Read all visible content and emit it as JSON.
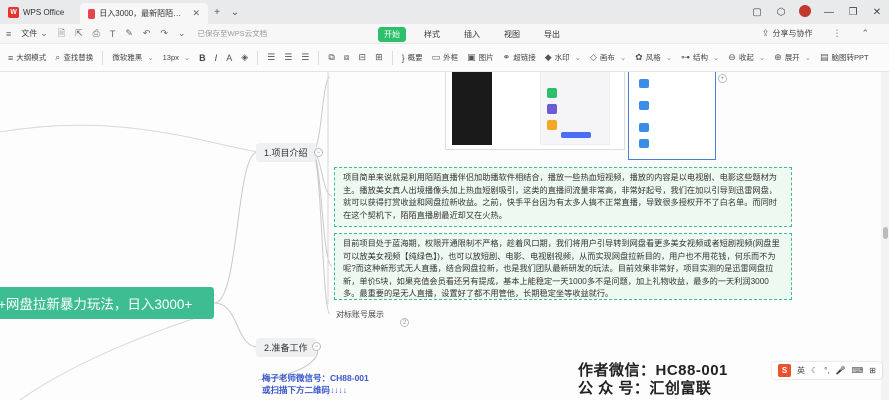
{
  "tabs": {
    "home_label": "WPS Office",
    "doc_label": "日入3000，最新陌陌无人直播网盘",
    "new_tab": "+"
  },
  "menubar": {
    "file": "文件",
    "saved_status": "已保存至WPS云文档",
    "tabs": [
      "开始",
      "样式",
      "插入",
      "视图",
      "导出"
    ],
    "share": "分享与协作"
  },
  "toolbar": {
    "outline": "大纲模式",
    "find_replace": "查找替换",
    "font": "微软雅黑",
    "font_size": "13px",
    "bold": "B",
    "italic": "I",
    "summary": "概要",
    "frame": "外框",
    "image": "图片",
    "hyperlink": "超链接",
    "watermark": "水印",
    "canvas": "画布",
    "style": "风格",
    "structure": "结构",
    "collapse": "收起",
    "expand": "展开",
    "to_ppt": "脑图转PPT"
  },
  "mindmap": {
    "root": "+网盘拉新暴力玩法，日入3000+",
    "topic1": "1.项目介绍",
    "topic1_text1": "项目简单来说就是利用陌陌直播伴侣加助播软件相结合，播放一些热血短视频，播放的内容是以电视剧、电影这些题材为主。播放美女真人出境播像头加上热血短剧吸引，这类的直播间流量非常高，非常好起号，我们在加以引导到迅雷网盘，就可以获得打赏收益和网盘拉新收益。之前，快手平台因为有太多人搞不正常直播，导致很多授权开不了白名单。而同时在这个契机下，陌陌直播剧最近却又在火热。",
    "topic1_text2": "目前项目处于蓝海期，权限开通限制不严格，趁着风口期，我们将用户引导转到网盘看更多美女视频或者短剧视频(网盘里可以放美女视频【纯绿色】)，也可以放短剧、电影、电视剧视频，从而实现网盘拉新目的，用户也不用花钱，何乐而不为呢?而这种新形式无人直播，结合网盘拉新，也是我们团队最新研发的玩法。目前效果非常好，项目实测的是迅雷网盘拉新，单价5块，如果充值会员看还另有提成，基本上能稳定一天1000多不是问题，加上礼物收益，最多的一天利润3000多。最重要的是无人直播，设置好了都不用管他，长期稳定坐等收益就行。",
    "subtopic": "对标账号展示",
    "topic2": "2.准备工作",
    "note_line1": "梅子老师微信号：CH88-001",
    "note_line2": "或扫描下方二维码↓↓↓↓",
    "watermark_line1": "作者微信：HC88-001",
    "watermark_line2": "公 众 号：汇创富联"
  },
  "ime": {
    "lang": "英"
  }
}
